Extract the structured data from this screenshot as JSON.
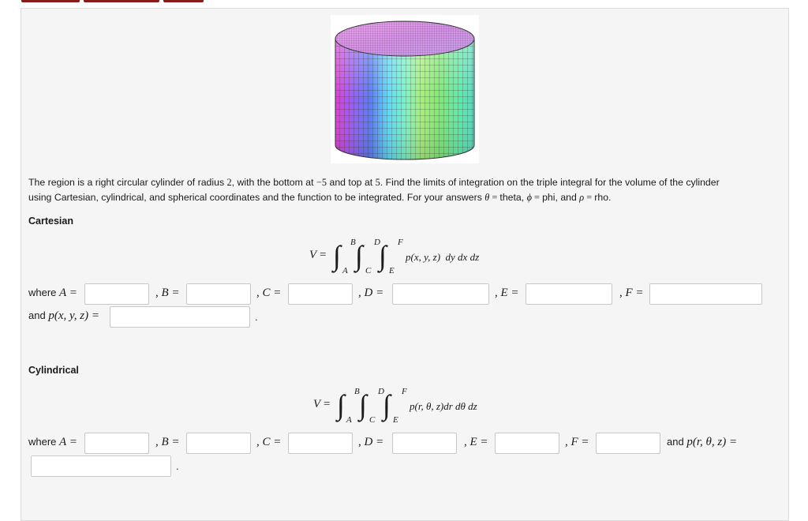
{
  "problem": {
    "line1_a": "The region is a right circular cylinder of radius ",
    "radius": "2",
    "line1_b": ", with the bottom at ",
    "bottom": "−5",
    "line1_c": " and top at ",
    "top": "5",
    "line1_d": ". Find the limits of integration on the triple integral for the volume of the cylinder",
    "line2_a": "using Cartesian, cylindrical, and spherical coordinates and the function to be integrated. For your answers ",
    "theta_sym": "θ",
    "eq1": " = ",
    "theta_word": "theta, ",
    "phi_sym": "ϕ",
    "eq2": " = ",
    "phi_word": "phi, and ",
    "rho_sym": "ρ",
    "eq3": " = ",
    "rho_word": "rho."
  },
  "cartesian": {
    "heading": "Cartesian",
    "V": "V",
    "eq": "=",
    "lim_B": "B",
    "lim_A": "A",
    "lim_D": "D",
    "lim_C": "C",
    "lim_F": "F",
    "lim_E": "E",
    "integrand": "p(x, y, z)  dy dx dz",
    "where": "where",
    "A_lbl": "A =",
    "B_lbl": ", B =",
    "C_lbl": ", C =",
    "D_lbl": ", D =",
    "E_lbl": ", E =",
    "F_lbl": ", F =",
    "and": "and",
    "p_lbl": "p(x, y, z) =",
    "period": "."
  },
  "cylindrical": {
    "heading": "Cylindrical",
    "V": "V",
    "eq": "=",
    "lim_B": "B",
    "lim_A": "A",
    "lim_D": "D",
    "lim_C": "C",
    "lim_F": "F",
    "lim_E": "E",
    "integrand": "p(r, θ, z)dr dθ dz",
    "where": "where",
    "A_lbl": "A =",
    "B_lbl": ", B =",
    "C_lbl": ", C =",
    "D_lbl": ", D =",
    "E_lbl": ", E =",
    "F_lbl": ", F =",
    "and": "and",
    "p_lbl": "p(r, θ, z) =",
    "period": "."
  },
  "colors": {
    "brand": "#8b1a1a",
    "panel": "#f5f5f5",
    "input_border": "#c8c8c8"
  },
  "figure": {
    "icon": "rainbow-cylinder-image"
  }
}
